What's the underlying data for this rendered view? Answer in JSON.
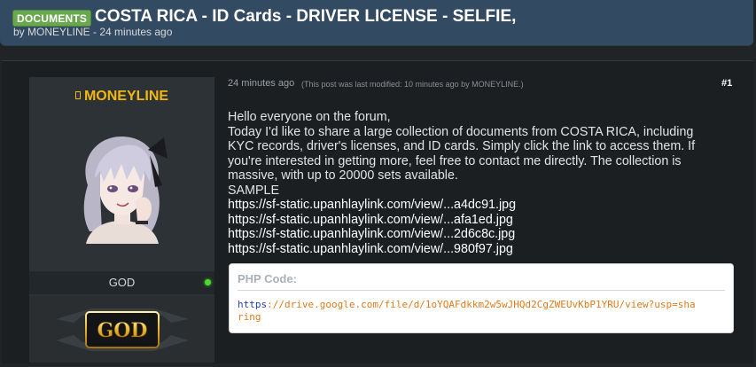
{
  "thread": {
    "prefix": "DOCUMENTS",
    "title": "COSTA RICA - ID Cards - DRIVER LICENSE - SELFIE,",
    "meta": "by MONEYLINE - 24 minutes ago"
  },
  "user": {
    "name": "MONEYLINE",
    "rank_title": "GOD",
    "rank_badge_text": "GOD",
    "online": true
  },
  "post": {
    "time": "24 minutes ago",
    "modified": "(This post was last modified: 10 minutes ago by MONEYLINE.)",
    "number": "#1",
    "lines": [
      "Hello everyone on the forum,",
      "Today I'd like to share a large collection of documents from COSTA RICA, including",
      "KYC records, driver's licenses, and ID cards. Simply click the link to access them. If",
      "you're interested in getting more, feel free to contact me directly. The collection is",
      "massive, with up to 20000 sets available.",
      "SAMPLE"
    ],
    "links": [
      "https://sf-static.upanhlaylink.com/view/...a4dc91.jpg",
      "https://sf-static.upanhlaylink.com/view/...afa1ed.jpg",
      "https://sf-static.upanhlaylink.com/view/...2d6c8c.jpg",
      "https://sf-static.upanhlaylink.com/view/...980f97.jpg"
    ],
    "code": {
      "title": "PHP Code:",
      "protocol": "https",
      "rest": "://drive.google.com/file/d/1oYQAFdkkm2w5wJHQd2CgZWEUvKbP1YRU/view?usp=sharing"
    }
  },
  "colors": {
    "header_bg": "#334a63",
    "prefix_bg": "#6aa84f",
    "username": "#f2b70f",
    "online": "#4bdc2b",
    "code_string": "#e07b1a",
    "code_keyword": "#1f3fb6"
  },
  "icons": [
    "user-icon",
    "online-status-icon",
    "avatar-image",
    "rank-badge-image"
  ]
}
